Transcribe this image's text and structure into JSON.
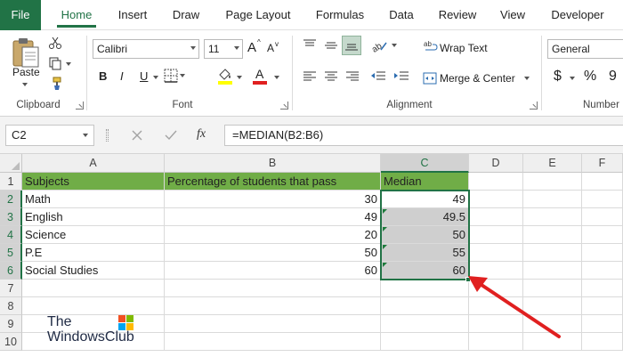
{
  "tabs": [
    {
      "id": "file",
      "label": "File"
    },
    {
      "id": "home",
      "label": "Home"
    },
    {
      "id": "insert",
      "label": "Insert"
    },
    {
      "id": "draw",
      "label": "Draw"
    },
    {
      "id": "page_layout",
      "label": "Page Layout"
    },
    {
      "id": "formulas",
      "label": "Formulas"
    },
    {
      "id": "data",
      "label": "Data"
    },
    {
      "id": "review",
      "label": "Review"
    },
    {
      "id": "view",
      "label": "View"
    },
    {
      "id": "developer",
      "label": "Developer"
    }
  ],
  "ribbon": {
    "clipboard": {
      "label": "Clipboard",
      "paste": "Paste"
    },
    "font": {
      "label": "Font",
      "name": "Calibri",
      "size": "11",
      "grow": "A",
      "shrink": "A",
      "bold": "B",
      "italic": "I",
      "underline": "U",
      "font_color": "A"
    },
    "alignment": {
      "label": "Alignment",
      "wrap_text": "Wrap Text",
      "merge_center": "Merge & Center"
    },
    "number": {
      "label": "Number",
      "format": "General",
      "currency": "$",
      "percent": "%",
      "comma": "9"
    }
  },
  "formula_bar": {
    "name_box": "C2",
    "fx": "fx",
    "formula": "=MEDIAN(B2:B6)"
  },
  "columns": [
    "A",
    "B",
    "C",
    "D",
    "E",
    "F"
  ],
  "rows": [
    "1",
    "2",
    "3",
    "4",
    "5",
    "6",
    "7",
    "8",
    "9",
    "10"
  ],
  "table": {
    "headers": [
      "Subjects",
      "Percentage of students that pass",
      "Median"
    ],
    "data": [
      [
        "Math",
        "30",
        "49"
      ],
      [
        "English",
        "49",
        "49.5"
      ],
      [
        "Science",
        "20",
        "50"
      ],
      [
        "P.E",
        "50",
        "55"
      ],
      [
        "Social Studies",
        "60",
        "60"
      ]
    ]
  },
  "watermark": {
    "line1": "The",
    "line2": "WindowsClub"
  },
  "colors": {
    "excel_green": "#217346",
    "header_fill": "#70ad47",
    "median_fill": "#cfcfcf",
    "arrow": "#e02020"
  }
}
